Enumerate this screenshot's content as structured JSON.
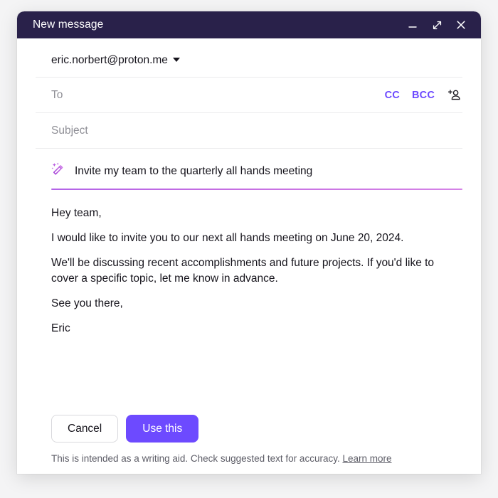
{
  "window": {
    "title": "New message",
    "controls": [
      {
        "name": "minimize-button",
        "glyph": "minimize-icon",
        "label": "Minimize"
      },
      {
        "name": "maximize-button",
        "glyph": "expand-icon",
        "label": "Maximize"
      },
      {
        "name": "close-button",
        "glyph": "close-icon",
        "label": "Close"
      }
    ]
  },
  "compose": {
    "from_address": "eric.norbert@proton.me",
    "to_placeholder": "To",
    "subject_placeholder": "Subject",
    "cc_label": "CC",
    "bcc_label": "BCC",
    "contact_icon": "add-contact-icon"
  },
  "assistant": {
    "wand_icon": "magic-wand-icon",
    "prompt_text": "Invite my team to the quarterly all hands meeting",
    "body_paragraphs": [
      "Hey team,",
      "I would like to invite you to our next all hands meeting on June 20, 2024.",
      "We'll be discussing recent accomplishments and future projects. If you'd like to cover a specific topic, let me know in advance.",
      "See you there,",
      "Eric"
    ],
    "cancel_label": "Cancel",
    "use_this_label": "Use this",
    "disclaimer_text": "This is intended as a writing aid. Check suggested text for accuracy.",
    "learn_more_label": "Learn more"
  },
  "colors": {
    "titlebar": "#29214a",
    "accent_purple": "#6d4aff",
    "wand_purple": "#b44ae0",
    "underline_gradient_start": "#b364e8",
    "underline_gradient_end": "#d583e6",
    "page_background": "#f4f4f5"
  }
}
